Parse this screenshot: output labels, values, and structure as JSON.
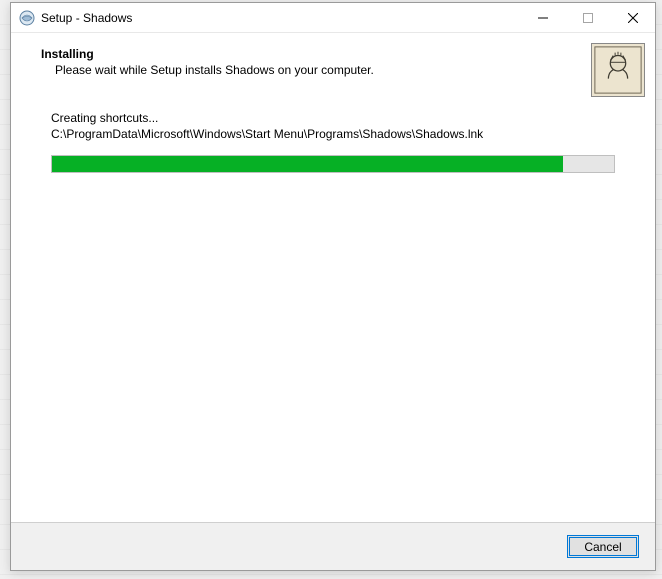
{
  "titlebar": {
    "title": "Setup - Shadows"
  },
  "header": {
    "heading": "Installing",
    "subheading": "Please wait while Setup installs Shadows on your computer."
  },
  "content": {
    "status": "Creating shortcuts...",
    "path": "C:\\ProgramData\\Microsoft\\Windows\\Start Menu\\Programs\\Shadows\\Shadows.lnk",
    "progress_percent": 91
  },
  "footer": {
    "cancel_label": "Cancel"
  }
}
